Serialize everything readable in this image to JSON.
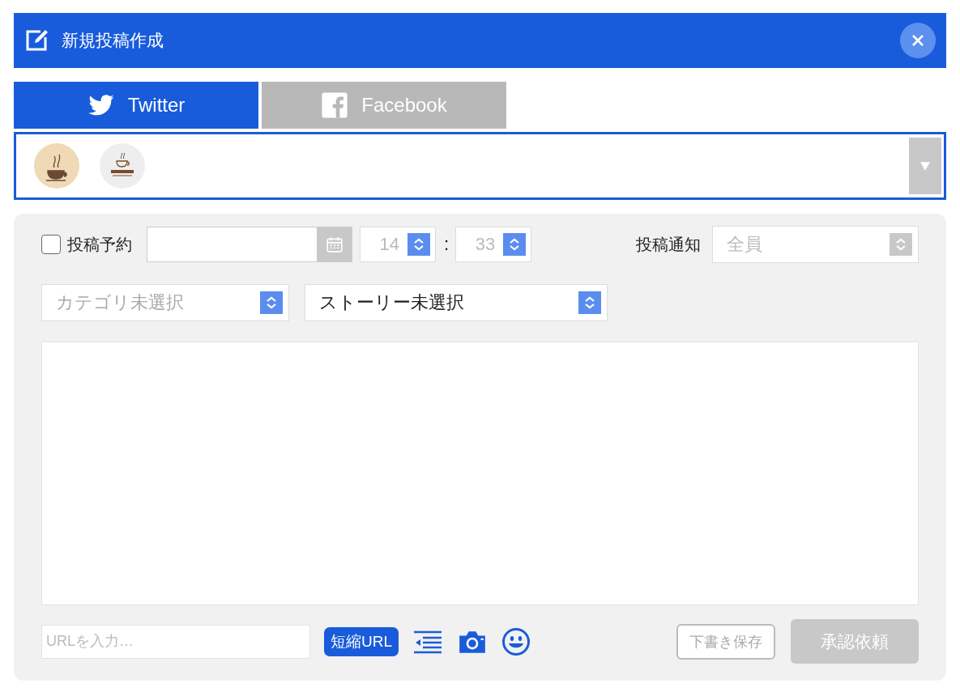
{
  "dialog": {
    "title": "新規投稿作成"
  },
  "tabs": [
    {
      "label": "Twitter",
      "selected": true,
      "kind": "twitter"
    },
    {
      "label": "Facebook",
      "selected": false,
      "kind": "facebook"
    }
  ],
  "accounts": [
    {
      "kind": "steam-cup"
    },
    {
      "kind": "cafe-logo"
    }
  ],
  "schedule": {
    "label": "投稿予約",
    "checked": false,
    "hour": "14",
    "separator": ":",
    "minute": "33",
    "disabled": true
  },
  "notify": {
    "label": "投稿通知",
    "value": "全員",
    "disabled": true
  },
  "category": {
    "placeholder": "カテゴリ未選択"
  },
  "story": {
    "value": "ストーリー未選択"
  },
  "url": {
    "placeholder": "URLを入力…",
    "shorten_button": "短縮URL"
  },
  "actions": [
    {
      "label": "下書き保存",
      "kind": "outline",
      "disabled": true
    },
    {
      "label": "承認依頼",
      "kind": "filled",
      "disabled": true
    }
  ]
}
